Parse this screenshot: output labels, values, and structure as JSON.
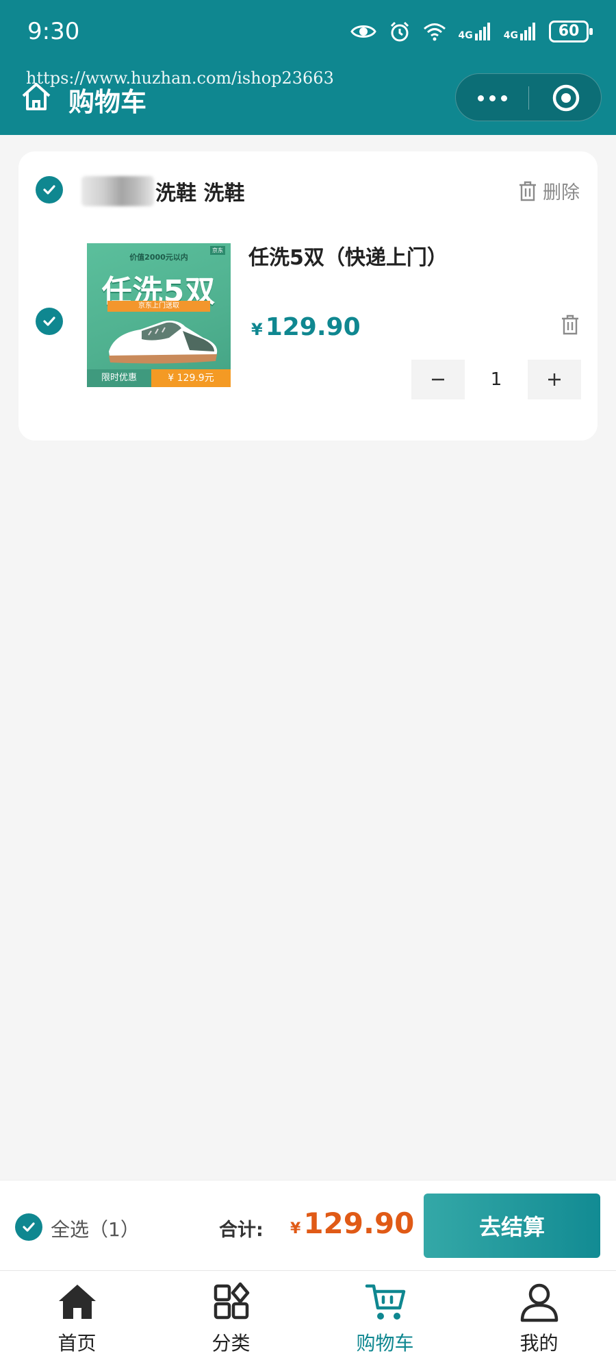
{
  "status_bar": {
    "time": "9:30",
    "network_1": "4G",
    "network_2": "4G",
    "battery": "60"
  },
  "watermark": "https://www.huzhan.com/ishop23663",
  "nav": {
    "title": "购物车",
    "icons": [
      "home-icon",
      "more-icon",
      "close-target-icon"
    ]
  },
  "cart": {
    "shop": {
      "name": "洗鞋 洗鞋",
      "delete_label": "删除"
    },
    "items": [
      {
        "title": "任洗5双（快递上门）",
        "price_currency": "¥",
        "price": "129.90",
        "quantity": "1",
        "image": {
          "top_text": "价值2000元以内",
          "logo_text": "京东",
          "big_text": "任洗5双",
          "band_text": "京东上门送取",
          "bottom_left": "限时优惠",
          "bottom_right": "¥ 129.9元"
        }
      }
    ]
  },
  "checkout": {
    "select_all_label": "全选（1）",
    "total_label": "合计:",
    "total_currency": "¥",
    "total_amount": "129.90",
    "button_label": "去结算"
  },
  "tabs": [
    {
      "label": "首页",
      "icon": "home-icon"
    },
    {
      "label": "分类",
      "icon": "category-icon"
    },
    {
      "label": "购物车",
      "icon": "cart-icon",
      "active": true
    },
    {
      "label": "我的",
      "icon": "user-icon"
    }
  ],
  "colors": {
    "brand": "#0f8790",
    "price_accent": "#e05a16",
    "background": "#f5f5f5"
  }
}
